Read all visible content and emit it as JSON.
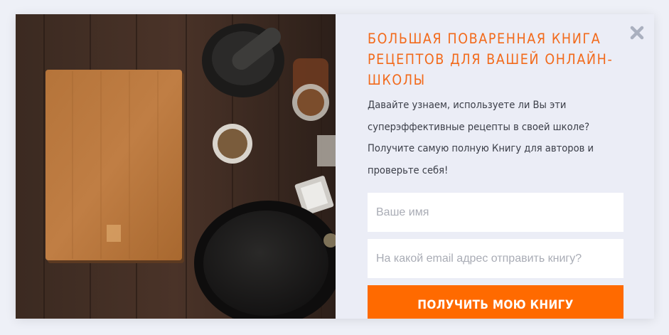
{
  "popup": {
    "title": "Большая поваренная книга рецептов для вашей онлайн-школы",
    "description": "Давайте узнаем, используете ли Вы эти суперэффективные рецепты в своей школе? Получите самую полную Книгу для авторов и проверьте себя!",
    "name_placeholder": "Ваше имя",
    "email_placeholder": "На какой email адрес отправить книгу?",
    "submit_label": "Получить мою книгу",
    "close_icon": "close-icon"
  },
  "colors": {
    "accent": "#f26a1b",
    "button": "#ff6a00",
    "panel_background": "#ebedf6",
    "text": "#3b3e48"
  }
}
